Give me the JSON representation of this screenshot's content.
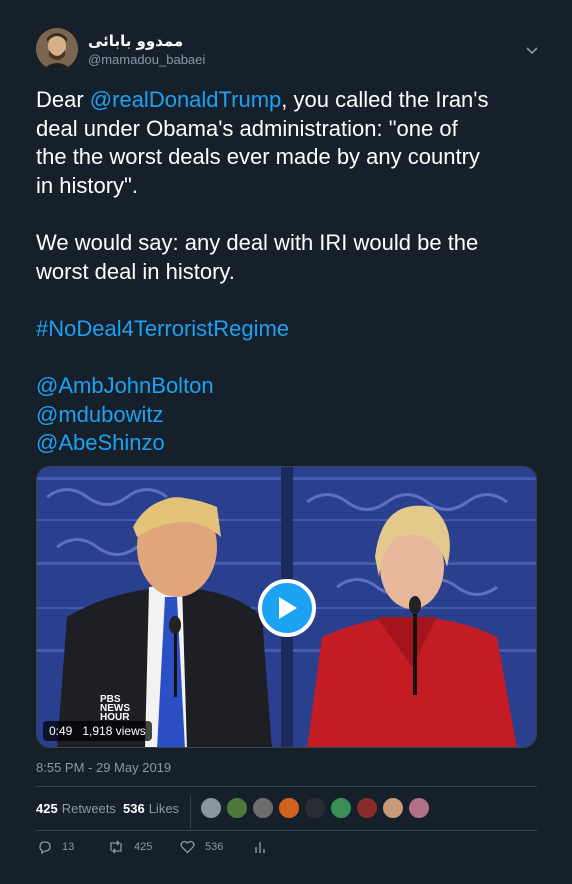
{
  "user": {
    "display_name": "ممدوو بابائی",
    "handle": "@mamadou_babaei"
  },
  "tweet": {
    "line1_prefix": "Dear ",
    "mention_trump": "@realDonaldTrump",
    "line1_suffix": ", you called the Iran's",
    "line2": "deal under Obama's administration: \"one of",
    "line3": "the the worst deals ever made by any country",
    "line4": "in history\".",
    "line5": "We would say: any deal with IRI would be the",
    "line6": "worst deal in history.",
    "hashtag": "#NoDeal4TerroristRegime",
    "mention_bolton": "@AmbJohnBolton",
    "mention_dubowitz": "@mdubowitz",
    "mention_abe": "@AbeShinzo"
  },
  "video": {
    "duration": "0:49",
    "views": "1,918 views",
    "badge_line1": "PBS",
    "badge_line2": "NEWS",
    "badge_line3": "HOUR"
  },
  "timestamp": "8:55 PM - 29 May 2019",
  "stats": {
    "retweets_count": "425",
    "retweets_label": "Retweets",
    "likes_count": "536",
    "likes_label": "Likes"
  },
  "actions": {
    "replies": "13",
    "retweets": "425",
    "likes": "536"
  },
  "colors": {
    "background": "#15202b",
    "link": "#1da1f2",
    "muted": "#8899a6",
    "border": "#38444d"
  }
}
